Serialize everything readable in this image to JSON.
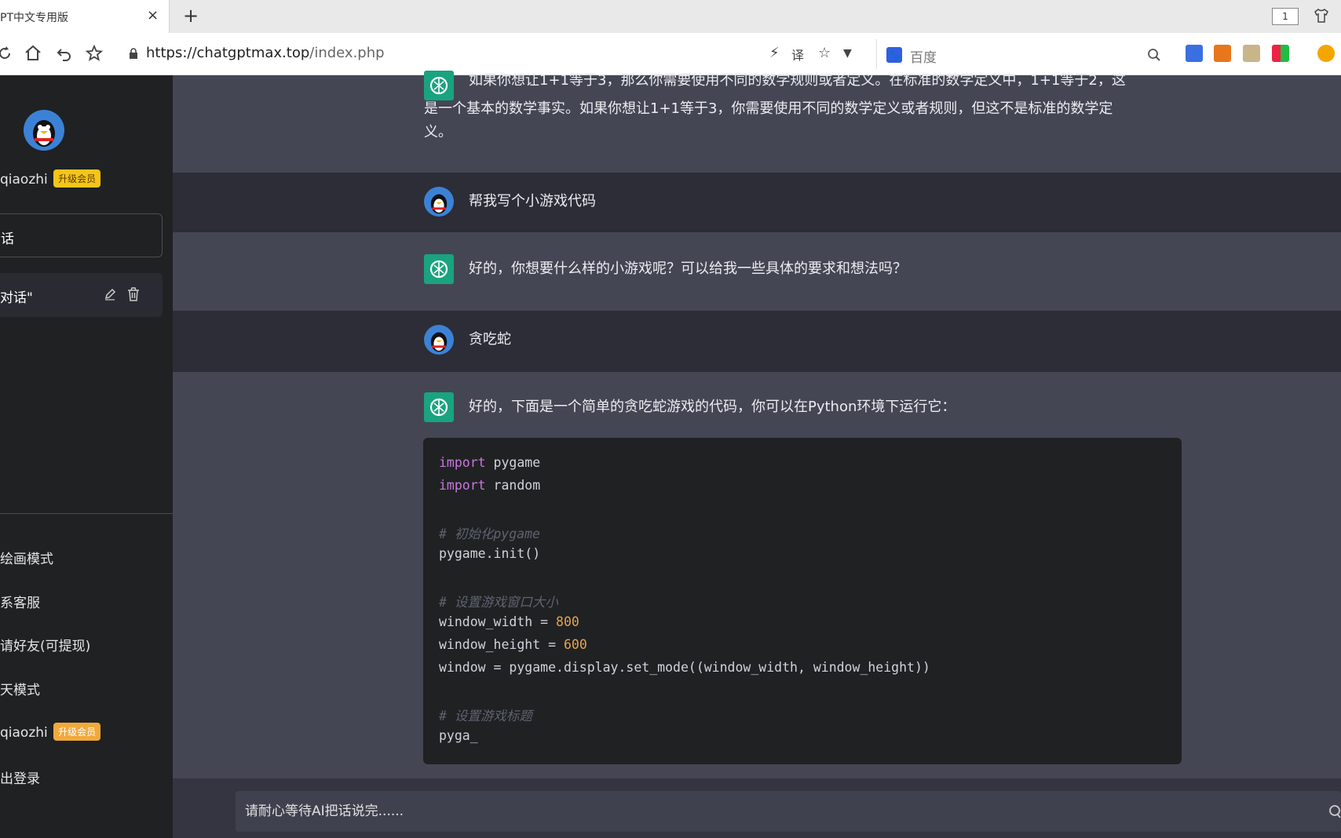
{
  "browser": {
    "tab_title": "PT中文专用版",
    "tab_close": "×",
    "new_tab": "+",
    "window_count": "1",
    "url_host": "https://chatgptmax.top",
    "url_path": "/index.php",
    "search_engine": "百度"
  },
  "sidebar": {
    "username": "qiaozhi",
    "badge": "升级会员",
    "new_chat_label": "话",
    "chat_item_label": "对话\"",
    "menu": [
      "绘画模式",
      "系客服",
      "请好友(可提现)",
      "天模式",
      "qiaozhi",
      "出登录"
    ],
    "bottom_badge": "升级会员"
  },
  "chat": {
    "messages": [
      {
        "role": "ai",
        "lines": [
          "如果你想让1+1等于3，那么你需要使用不同的数学规则或者定义。在标准的数学定义中，1+1等于2，这",
          "是一个基本的数学事实。如果你想让1+1等于3，你需要使用不同的数学定义或者规则，但这不是标准的数学定",
          "义。"
        ]
      },
      {
        "role": "user",
        "text": "帮我写个小游戏代码"
      },
      {
        "role": "ai",
        "text": "好的，你想要什么样的小游戏呢？可以给我一些具体的要求和想法吗？"
      },
      {
        "role": "user",
        "text": "贪吃蛇"
      },
      {
        "role": "ai",
        "text": "好的，下面是一个简单的贪吃蛇游戏的代码，你可以在Python环境下运行它："
      }
    ],
    "code": {
      "kw_import": "import",
      "l1_rest": " pygame",
      "l2_rest": " random",
      "c1": "# 初始化pygame",
      "l3": "pygame.init()",
      "c2": "# 设置游戏窗口大小",
      "l4_pre": "window_width = ",
      "l4_num": "800",
      "l5_pre": "window_height = ",
      "l5_num": "600",
      "l6": "window = pygame.display.set_mode((window_width, window_height))",
      "c3": "# 设置游戏标题",
      "l7": "pyga_"
    }
  },
  "input": {
    "placeholder": "请耐心等待AI把话说完......"
  }
}
